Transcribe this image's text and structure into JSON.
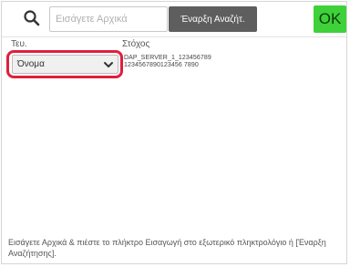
{
  "search": {
    "placeholder": "Εισάγετε Αρχικά",
    "button_label": "Έναρξη Αναζήτ."
  },
  "ok_label": "OK",
  "columns": {
    "type_header": "Τευ.",
    "target_header": "Στόχος"
  },
  "type_select": {
    "selected": "Όνομα"
  },
  "targets": [
    "DAP_SERVER_1_123456789",
    "1234567890123456 7890"
  ],
  "footer": {
    "hint": "Εισάγετε Αρχικά & πιέστε το πλήκτρο Εισαγωγή στο εξωτερικό πληκτρολόγιο ή [Έναρξη Αναζήτησης]."
  },
  "colors": {
    "accent_green": "#3ed13a",
    "highlight_red": "#e01f3d",
    "button_gray": "#5e5e5e"
  },
  "icons": {
    "search": "search-icon",
    "dropdown": "chevron-down-icon"
  }
}
